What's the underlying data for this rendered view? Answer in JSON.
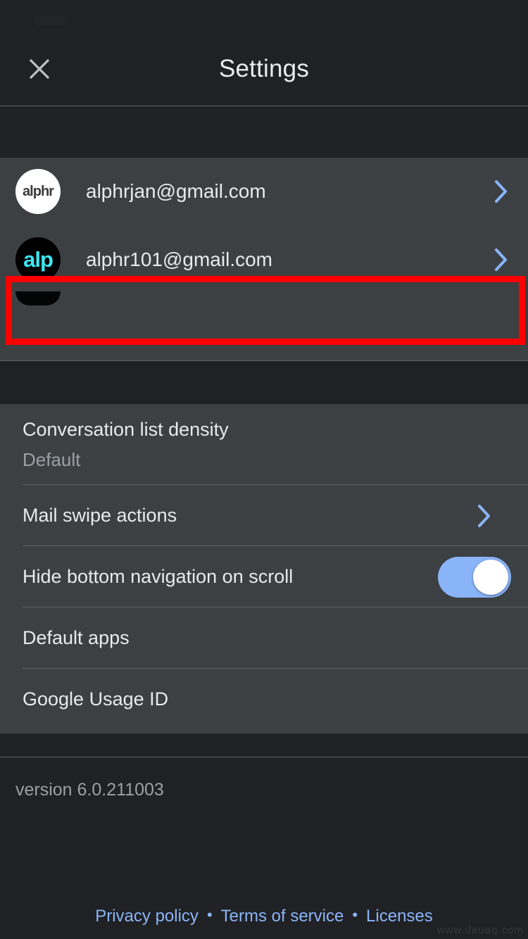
{
  "app": {
    "title": "Settings",
    "version": "version 6.0.211003"
  },
  "colors": {
    "page_background": "#202124",
    "card_background": "#3c4043",
    "accent_blue": "#8ab4f8",
    "primary_text": "#e8eaed",
    "secondary_text": "#9aa0a6",
    "divider": "#5f6368",
    "highlight_outline": "#ff0000",
    "avatar_cyan": "#3ee6f0"
  },
  "appbar": {
    "close_icon": "close-icon",
    "title": "Settings"
  },
  "accounts": {
    "items": [
      {
        "email": "alphrjan@gmail.com",
        "avatar_text": "alphr",
        "avatar_style": "white",
        "chevron_icon": "chevron-right-icon"
      },
      {
        "email": "alphr101@gmail.com",
        "avatar_text": "alp",
        "avatar_style": "black",
        "chevron_icon": "chevron-right-icon",
        "highlighted": true
      }
    ]
  },
  "settings": {
    "items": [
      {
        "title": "Conversation list density",
        "subtitle": "Default",
        "control": "none"
      },
      {
        "title": "Mail swipe actions",
        "subtitle": "",
        "control": "chevron",
        "chevron_icon": "chevron-right-icon"
      },
      {
        "title": "Hide bottom navigation on scroll",
        "subtitle": "",
        "control": "toggle",
        "toggle_on": true
      },
      {
        "title": "Default apps",
        "subtitle": "",
        "control": "none"
      },
      {
        "title": "Google Usage ID",
        "subtitle": "",
        "control": "none"
      }
    ]
  },
  "footer": {
    "links": [
      {
        "label": "Privacy policy"
      },
      {
        "label": "Terms of service"
      },
      {
        "label": "Licenses"
      }
    ],
    "separator": "•"
  },
  "watermark": {
    "text": "www.deuaq.com"
  }
}
